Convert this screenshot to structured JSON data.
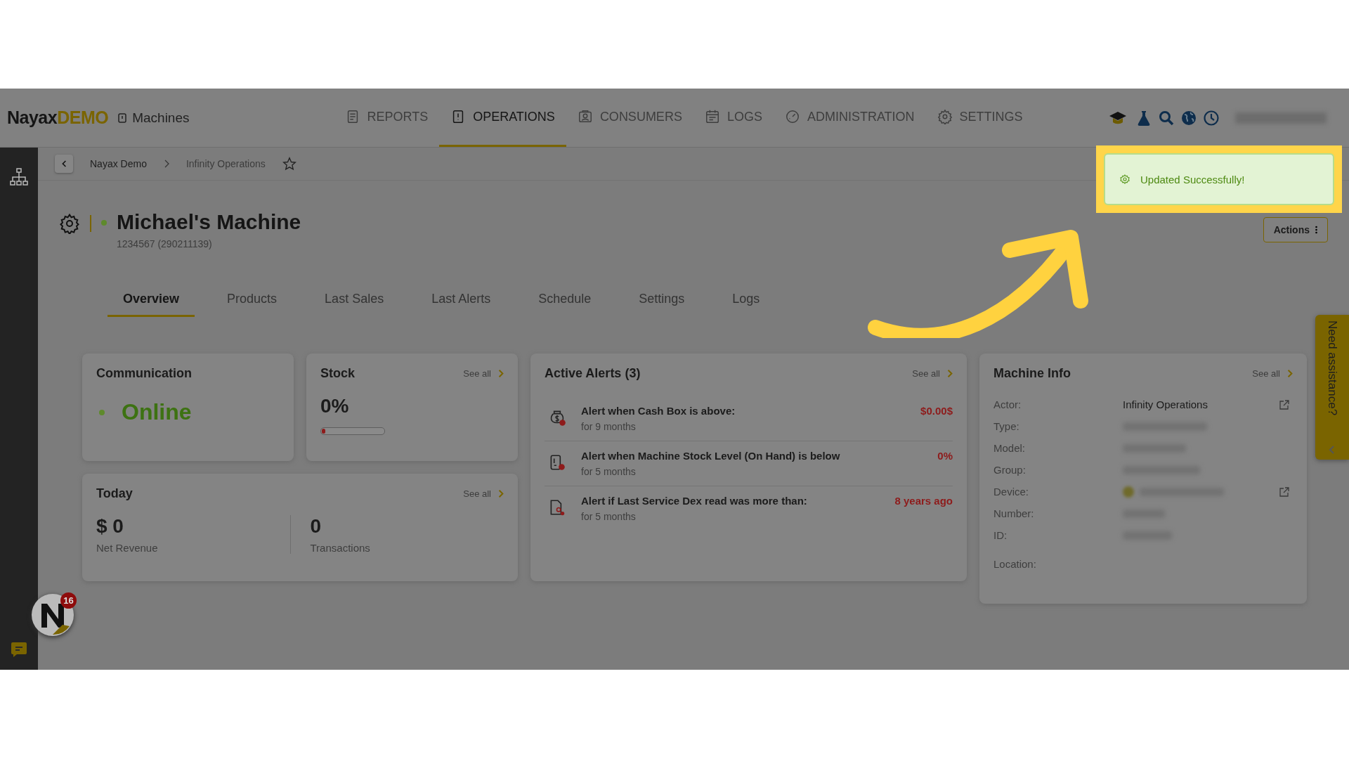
{
  "header": {
    "brand": "Nayax",
    "brand_suffix": "DEMO",
    "section": "Machines",
    "nav": [
      {
        "label": "REPORTS",
        "kind": "report",
        "selected": false
      },
      {
        "label": "OPERATIONS",
        "kind": "tablet",
        "selected": true
      },
      {
        "label": "CONSUMERS",
        "kind": "consumer",
        "selected": false
      },
      {
        "label": "LOGS",
        "kind": "log",
        "selected": false
      },
      {
        "label": "ADMINISTRATION",
        "kind": "gauge",
        "selected": false
      },
      {
        "label": "SETTINGS",
        "kind": "gear",
        "selected": false
      }
    ]
  },
  "breadcrumb": [
    "Nayax Demo",
    "Infinity Operations"
  ],
  "machine": {
    "online": true,
    "name": "Michael's Machine",
    "id": "1234567 (290211139)"
  },
  "actions_button": "Actions",
  "tabs": [
    {
      "label": "Overview",
      "selected": true
    },
    {
      "label": "Products",
      "selected": false
    },
    {
      "label": "Last Sales",
      "selected": false
    },
    {
      "label": "Last Alerts",
      "selected": false
    },
    {
      "label": "Schedule",
      "selected": false
    },
    {
      "label": "Settings",
      "selected": false
    },
    {
      "label": "Logs",
      "selected": false
    }
  ],
  "communication": {
    "title": "Communication",
    "status": "Online",
    "online": true
  },
  "stock": {
    "title": "Stock",
    "see_all": "See all",
    "value": "0%",
    "level": 0
  },
  "today": {
    "title": "Today",
    "see_all": "See all",
    "revenue": "$ 0",
    "revenue_label": "Net Revenue",
    "transactions": "0",
    "transactions_label": "Transactions"
  },
  "alerts": {
    "title": "Active Alerts (3)",
    "see_all": "See all",
    "items": [
      {
        "kind": "cash",
        "title": "Alert when Cash Box is above:",
        "duration": "for 9 months",
        "value": "$0.00$"
      },
      {
        "kind": "stock",
        "title": "Alert when Machine Stock Level (On Hand) is below",
        "duration": "for 5 months",
        "value": "0%"
      },
      {
        "kind": "service",
        "title": "Alert if Last Service Dex read was more than:",
        "duration": "for 5 months",
        "value": "8 years ago"
      }
    ]
  },
  "machine_info": {
    "title": "Machine Info",
    "see_all": "See all",
    "fields": [
      {
        "label": "Actor:",
        "kind": "text",
        "value": "Infinity Operations",
        "link": true
      },
      {
        "label": "Type:",
        "kind": "redacted",
        "link": false
      },
      {
        "label": "Model:",
        "kind": "redacted",
        "link": false
      },
      {
        "label": "Group:",
        "kind": "redacted",
        "link": false
      },
      {
        "label": "Device:",
        "kind": "redacted",
        "link": true
      },
      {
        "label": "Number:",
        "kind": "redacted",
        "link": false
      },
      {
        "label": "ID:",
        "kind": "redacted",
        "link": false
      },
      {
        "label": "Location:",
        "kind": "empty",
        "link": false
      }
    ]
  },
  "toast": {
    "message": "Updated Successfully!"
  },
  "help_tab": {
    "label": "Need assistance?"
  },
  "notification_count": "16"
}
